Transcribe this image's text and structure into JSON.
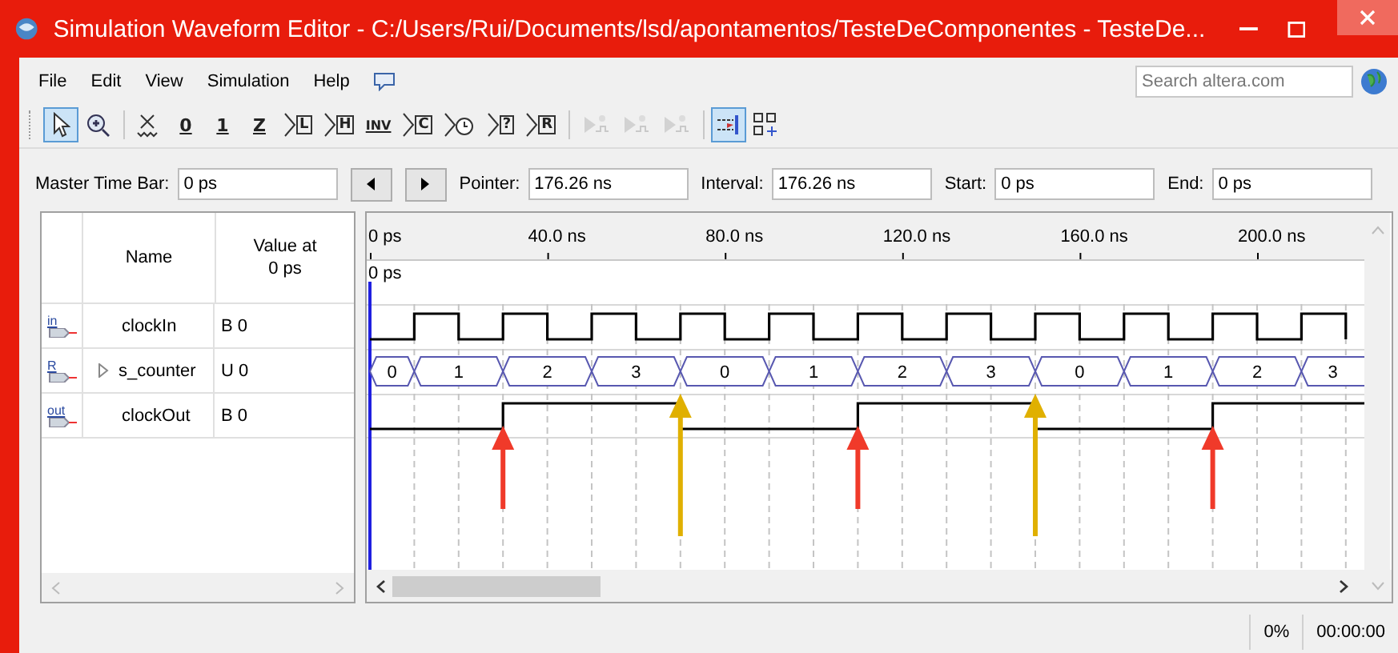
{
  "window": {
    "title": "Simulation Waveform Editor - C:/Users/Rui/Documents/lsd/apontamentos/TesteDeComponentes - TesteDe..."
  },
  "menu": [
    "File",
    "Edit",
    "View",
    "Simulation",
    "Help"
  ],
  "search": {
    "placeholder": "Search altera.com"
  },
  "toolbar": [
    {
      "kind": "pointer",
      "selected": true,
      "disabled": false
    },
    {
      "kind": "zoom",
      "selected": false,
      "disabled": false
    },
    {
      "kind": "sep"
    },
    {
      "kind": "unknown",
      "selected": false,
      "disabled": false
    },
    {
      "kind": "letter",
      "label": "0",
      "selected": false,
      "disabled": false
    },
    {
      "kind": "letter",
      "label": "1",
      "selected": false,
      "disabled": false
    },
    {
      "kind": "letter",
      "label": "Z",
      "selected": false,
      "disabled": false
    },
    {
      "kind": "boxed",
      "label": "L",
      "selected": false,
      "disabled": false
    },
    {
      "kind": "boxed",
      "label": "H",
      "selected": false,
      "disabled": false
    },
    {
      "kind": "letter",
      "label": "INV",
      "selected": false,
      "disabled": false
    },
    {
      "kind": "boxed",
      "label": "C",
      "selected": false,
      "disabled": false
    },
    {
      "kind": "clock",
      "selected": false,
      "disabled": false
    },
    {
      "kind": "boxed",
      "label": "?",
      "selected": false,
      "disabled": false
    },
    {
      "kind": "boxed",
      "label": "R",
      "selected": false,
      "disabled": false
    },
    {
      "kind": "sep"
    },
    {
      "kind": "run",
      "selected": false,
      "disabled": true
    },
    {
      "kind": "run",
      "selected": false,
      "disabled": true
    },
    {
      "kind": "run",
      "selected": false,
      "disabled": true
    },
    {
      "kind": "sep"
    },
    {
      "kind": "snap",
      "selected": true,
      "disabled": false
    },
    {
      "kind": "grid",
      "selected": false,
      "disabled": false
    }
  ],
  "time_bar": {
    "master_label": "Master Time Bar:",
    "master": "0 ps",
    "pointer_label": "Pointer:",
    "pointer": "176.26 ns",
    "interval_label": "Interval:",
    "interval": "176.26 ns",
    "start_label": "Start:",
    "start": "0 ps",
    "end_label": "End:",
    "end": "0 ps"
  },
  "table": {
    "columns": [
      "Name",
      "Value at\n0 ps"
    ],
    "rows": [
      {
        "kind": "input",
        "icon_text": "in",
        "name": "clockIn",
        "value": "B 0"
      },
      {
        "kind": "bus",
        "icon_text": "R",
        "name": "s_counter",
        "value": "U 0",
        "expanded": false,
        "segments": [
          "0",
          "1",
          "2",
          "3",
          "0",
          "1",
          "2",
          "3",
          "0",
          "1",
          "2",
          "3"
        ]
      },
      {
        "kind": "output",
        "icon_text": "out",
        "name": "clockOut",
        "value": "B 0"
      }
    ]
  },
  "ruler": [
    "0 ps",
    "40.0 ns",
    "80.0 ns",
    "120.0 ns",
    "160.0 ns",
    "200.0 ns"
  ],
  "master_marker": "0 ps",
  "annotations": [
    {
      "color": "#f03a2a"
    },
    {
      "color": "#e0b000"
    },
    {
      "color": "#f03a2a"
    },
    {
      "color": "#e0b000"
    },
    {
      "color": "#f03a2a"
    }
  ],
  "status_bar": {
    "progress": "0%",
    "time": "00:00:00"
  }
}
